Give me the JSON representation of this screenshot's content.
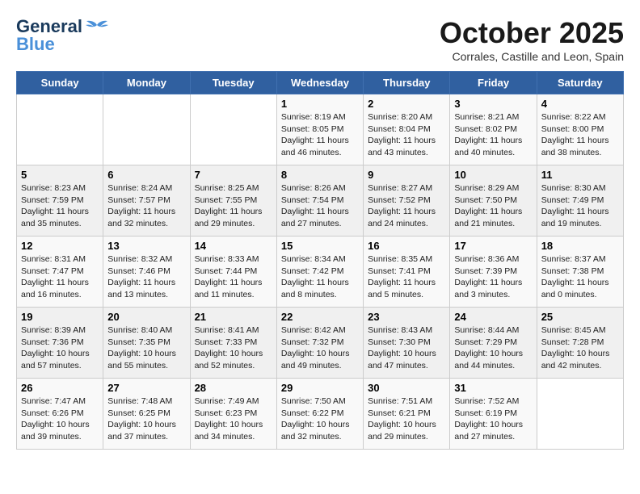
{
  "header": {
    "logo_line1": "General",
    "logo_line2": "Blue",
    "month": "October 2025",
    "location": "Corrales, Castille and Leon, Spain"
  },
  "weekdays": [
    "Sunday",
    "Monday",
    "Tuesday",
    "Wednesday",
    "Thursday",
    "Friday",
    "Saturday"
  ],
  "weeks": [
    [
      {
        "day": "",
        "info": ""
      },
      {
        "day": "",
        "info": ""
      },
      {
        "day": "",
        "info": ""
      },
      {
        "day": "1",
        "info": "Sunrise: 8:19 AM\nSunset: 8:05 PM\nDaylight: 11 hours\nand 46 minutes."
      },
      {
        "day": "2",
        "info": "Sunrise: 8:20 AM\nSunset: 8:04 PM\nDaylight: 11 hours\nand 43 minutes."
      },
      {
        "day": "3",
        "info": "Sunrise: 8:21 AM\nSunset: 8:02 PM\nDaylight: 11 hours\nand 40 minutes."
      },
      {
        "day": "4",
        "info": "Sunrise: 8:22 AM\nSunset: 8:00 PM\nDaylight: 11 hours\nand 38 minutes."
      }
    ],
    [
      {
        "day": "5",
        "info": "Sunrise: 8:23 AM\nSunset: 7:59 PM\nDaylight: 11 hours\nand 35 minutes."
      },
      {
        "day": "6",
        "info": "Sunrise: 8:24 AM\nSunset: 7:57 PM\nDaylight: 11 hours\nand 32 minutes."
      },
      {
        "day": "7",
        "info": "Sunrise: 8:25 AM\nSunset: 7:55 PM\nDaylight: 11 hours\nand 29 minutes."
      },
      {
        "day": "8",
        "info": "Sunrise: 8:26 AM\nSunset: 7:54 PM\nDaylight: 11 hours\nand 27 minutes."
      },
      {
        "day": "9",
        "info": "Sunrise: 8:27 AM\nSunset: 7:52 PM\nDaylight: 11 hours\nand 24 minutes."
      },
      {
        "day": "10",
        "info": "Sunrise: 8:29 AM\nSunset: 7:50 PM\nDaylight: 11 hours\nand 21 minutes."
      },
      {
        "day": "11",
        "info": "Sunrise: 8:30 AM\nSunset: 7:49 PM\nDaylight: 11 hours\nand 19 minutes."
      }
    ],
    [
      {
        "day": "12",
        "info": "Sunrise: 8:31 AM\nSunset: 7:47 PM\nDaylight: 11 hours\nand 16 minutes."
      },
      {
        "day": "13",
        "info": "Sunrise: 8:32 AM\nSunset: 7:46 PM\nDaylight: 11 hours\nand 13 minutes."
      },
      {
        "day": "14",
        "info": "Sunrise: 8:33 AM\nSunset: 7:44 PM\nDaylight: 11 hours\nand 11 minutes."
      },
      {
        "day": "15",
        "info": "Sunrise: 8:34 AM\nSunset: 7:42 PM\nDaylight: 11 hours\nand 8 minutes."
      },
      {
        "day": "16",
        "info": "Sunrise: 8:35 AM\nSunset: 7:41 PM\nDaylight: 11 hours\nand 5 minutes."
      },
      {
        "day": "17",
        "info": "Sunrise: 8:36 AM\nSunset: 7:39 PM\nDaylight: 11 hours\nand 3 minutes."
      },
      {
        "day": "18",
        "info": "Sunrise: 8:37 AM\nSunset: 7:38 PM\nDaylight: 11 hours\nand 0 minutes."
      }
    ],
    [
      {
        "day": "19",
        "info": "Sunrise: 8:39 AM\nSunset: 7:36 PM\nDaylight: 10 hours\nand 57 minutes."
      },
      {
        "day": "20",
        "info": "Sunrise: 8:40 AM\nSunset: 7:35 PM\nDaylight: 10 hours\nand 55 minutes."
      },
      {
        "day": "21",
        "info": "Sunrise: 8:41 AM\nSunset: 7:33 PM\nDaylight: 10 hours\nand 52 minutes."
      },
      {
        "day": "22",
        "info": "Sunrise: 8:42 AM\nSunset: 7:32 PM\nDaylight: 10 hours\nand 49 minutes."
      },
      {
        "day": "23",
        "info": "Sunrise: 8:43 AM\nSunset: 7:30 PM\nDaylight: 10 hours\nand 47 minutes."
      },
      {
        "day": "24",
        "info": "Sunrise: 8:44 AM\nSunset: 7:29 PM\nDaylight: 10 hours\nand 44 minutes."
      },
      {
        "day": "25",
        "info": "Sunrise: 8:45 AM\nSunset: 7:28 PM\nDaylight: 10 hours\nand 42 minutes."
      }
    ],
    [
      {
        "day": "26",
        "info": "Sunrise: 7:47 AM\nSunset: 6:26 PM\nDaylight: 10 hours\nand 39 minutes."
      },
      {
        "day": "27",
        "info": "Sunrise: 7:48 AM\nSunset: 6:25 PM\nDaylight: 10 hours\nand 37 minutes."
      },
      {
        "day": "28",
        "info": "Sunrise: 7:49 AM\nSunset: 6:23 PM\nDaylight: 10 hours\nand 34 minutes."
      },
      {
        "day": "29",
        "info": "Sunrise: 7:50 AM\nSunset: 6:22 PM\nDaylight: 10 hours\nand 32 minutes."
      },
      {
        "day": "30",
        "info": "Sunrise: 7:51 AM\nSunset: 6:21 PM\nDaylight: 10 hours\nand 29 minutes."
      },
      {
        "day": "31",
        "info": "Sunrise: 7:52 AM\nSunset: 6:19 PM\nDaylight: 10 hours\nand 27 minutes."
      },
      {
        "day": "",
        "info": ""
      }
    ]
  ]
}
